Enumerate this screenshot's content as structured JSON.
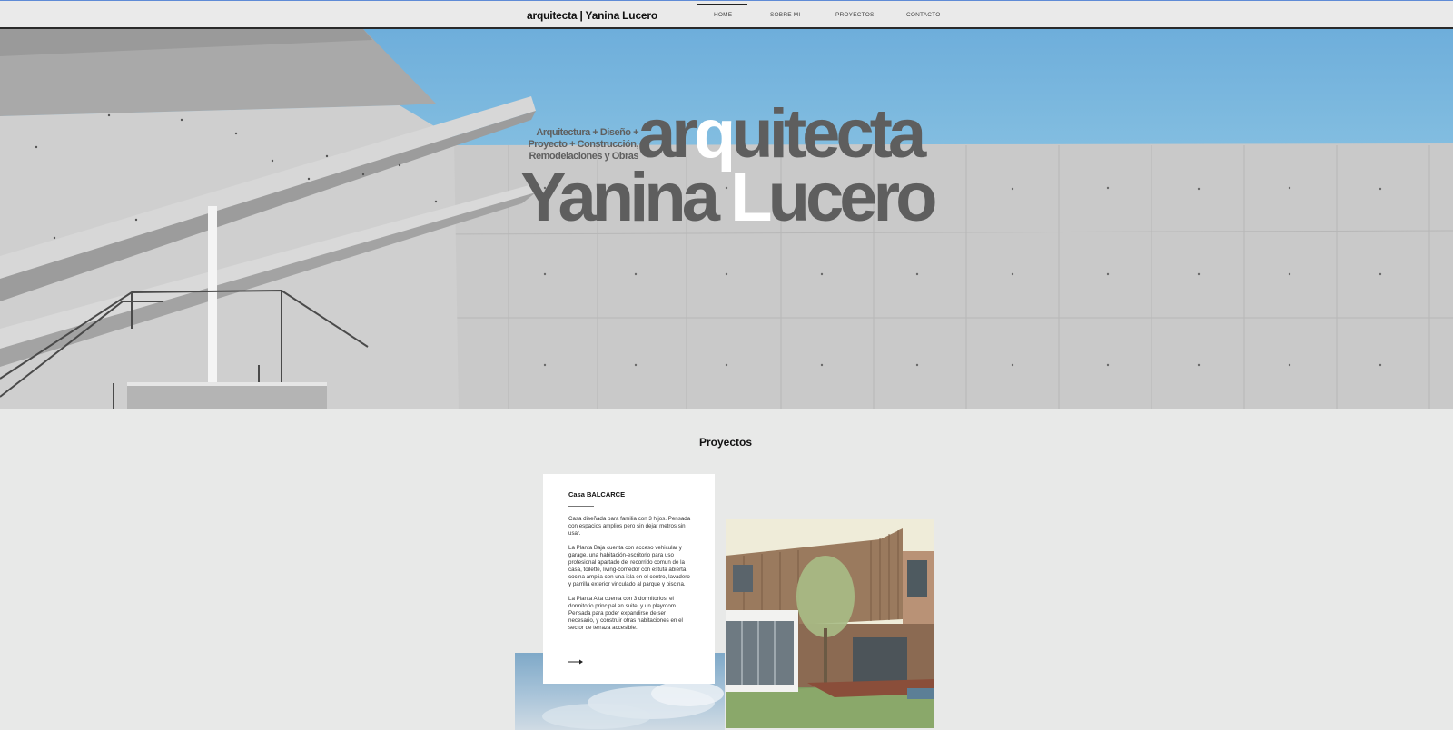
{
  "header": {
    "brand": "arquitecta | Yanina Lucero",
    "nav": [
      {
        "label": "HOME"
      },
      {
        "label": "SOBRE MI"
      },
      {
        "label": "PROYECTOS"
      },
      {
        "label": "CONTACTO"
      }
    ]
  },
  "hero": {
    "tagline_line1": "Arquitectura + Diseño +",
    "tagline_line2": "Proyecto + Construcción,",
    "tagline_line3": "Remodelaciones y Obras",
    "word1_a": "ar",
    "word1_q": "q",
    "word1_b": "uitecta",
    "word2_a": "Yanina ",
    "word2_l": "L",
    "word2_b": "ucero"
  },
  "projects": {
    "title": "Proyectos",
    "card": {
      "title": "Casa BALCARCE",
      "p1": "Casa diseñada para familia con 3 hijos. Pensada con espacios amplios pero sin dejar metros sin usar.",
      "p2": "La Planta Baja cuenta con acceso vehicular y garage, una habitación-escritorio para uso profesional apartado del recorrido comun de la casa, toilette, living-comedor con estufa abierta, cocina amplia con una isla en el centro, lavadero y parrilla exterior vinculado al parque y piscina.",
      "p3": "La Planta Alta cuenta con 3 dormitorios, el dormitorio principal en suite, y un playroom.",
      "p4": "Pensada para poder expandirse de ser necesario, y construir otras habitaciones en el sector de terraza accesible."
    }
  },
  "colors": {
    "accent_line": "#5f8bd6",
    "sky": "#7cb8dd",
    "concrete": "#c8c8c8",
    "page_bg": "#e8e9e8"
  }
}
